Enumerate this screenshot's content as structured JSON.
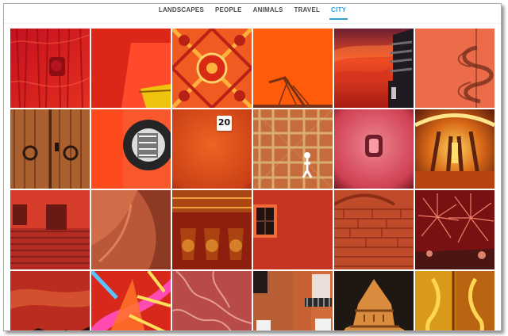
{
  "nav": {
    "tabs": [
      {
        "label": "LANDSCAPES",
        "active": false
      },
      {
        "label": "PEOPLE",
        "active": false
      },
      {
        "label": "ANIMALS",
        "active": false
      },
      {
        "label": "TRAVEL",
        "active": false
      },
      {
        "label": "CITY",
        "active": true
      }
    ],
    "active_color": "#2f9edb"
  },
  "gallery": {
    "photos": {
      "house_number": "20"
    }
  }
}
